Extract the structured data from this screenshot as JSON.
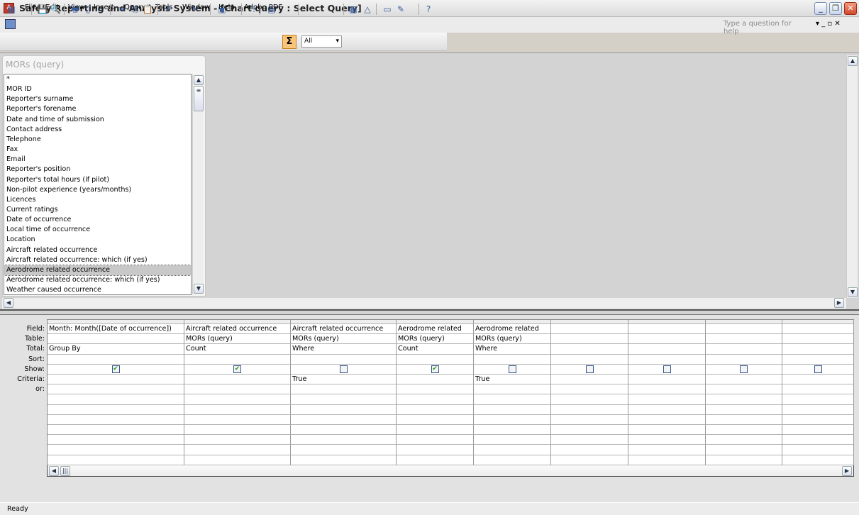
{
  "window": {
    "title": "Safety Reporting and Analysis System - [Chart query : Select Query]",
    "app_icon": "access-icon"
  },
  "menu": [
    "File",
    "Edit",
    "View",
    "Insert",
    "Query",
    "Tools",
    "Window",
    "Help",
    "Adobe PDF"
  ],
  "help_placeholder": "Type a question for help",
  "toolbar": {
    "top_values": "All",
    "sigma": "Σ"
  },
  "table": {
    "title": "MORs (query)",
    "fields": [
      "*",
      "MOR ID",
      "Reporter's surname",
      "Reporter's forename",
      "Date and time of submission",
      "Contact address",
      "Telephone",
      "Fax",
      "Email",
      "Reporter's position",
      "Reporter's total hours (if pilot)",
      "Non-pilot experience (years/months)",
      "Licences",
      "Current ratings",
      "Date of occurrence",
      "Local time of occurrence",
      "Location",
      "Aircraft related occurrence",
      "Aircraft related occurrence: which (if yes)",
      "Aerodrome related occurrence",
      "Aerodrome related occurrence: which (if yes)",
      "Weather caused occurrence"
    ],
    "selected_index": 19
  },
  "grid": {
    "row_labels": [
      "Field:",
      "Table:",
      "Total:",
      "Sort:",
      "Show:",
      "Criteria:",
      "or:"
    ],
    "columns": [
      {
        "field": "Month: Month([Date of occurrence])",
        "table": "",
        "total": "Group By",
        "sort": "",
        "show": true,
        "criteria": "",
        "or": ""
      },
      {
        "field": "Aircraft related occurrence",
        "table": "MORs (query)",
        "total": "Count",
        "sort": "",
        "show": true,
        "criteria": "",
        "or": ""
      },
      {
        "field": "Aircraft related occurrence",
        "table": "MORs (query)",
        "total": "Where",
        "sort": "",
        "show": false,
        "criteria": "True",
        "or": ""
      },
      {
        "field": "Aerodrome related",
        "table": "MORs (query)",
        "total": "Count",
        "sort": "",
        "show": true,
        "criteria": "",
        "or": ""
      },
      {
        "field": "Aerodrome related",
        "table": "MORs (query)",
        "total": "Where",
        "sort": "",
        "show": false,
        "criteria": "True",
        "or": ""
      },
      {
        "field": "",
        "table": "",
        "total": "",
        "sort": "",
        "show": false,
        "criteria": "",
        "or": ""
      },
      {
        "field": "",
        "table": "",
        "total": "",
        "sort": "",
        "show": false,
        "criteria": "",
        "or": ""
      },
      {
        "field": "",
        "table": "",
        "total": "",
        "sort": "",
        "show": false,
        "criteria": "",
        "or": ""
      },
      {
        "field": "",
        "table": "",
        "total": "",
        "sort": "",
        "show": false,
        "criteria": "",
        "or": ""
      }
    ]
  },
  "status": "Ready"
}
